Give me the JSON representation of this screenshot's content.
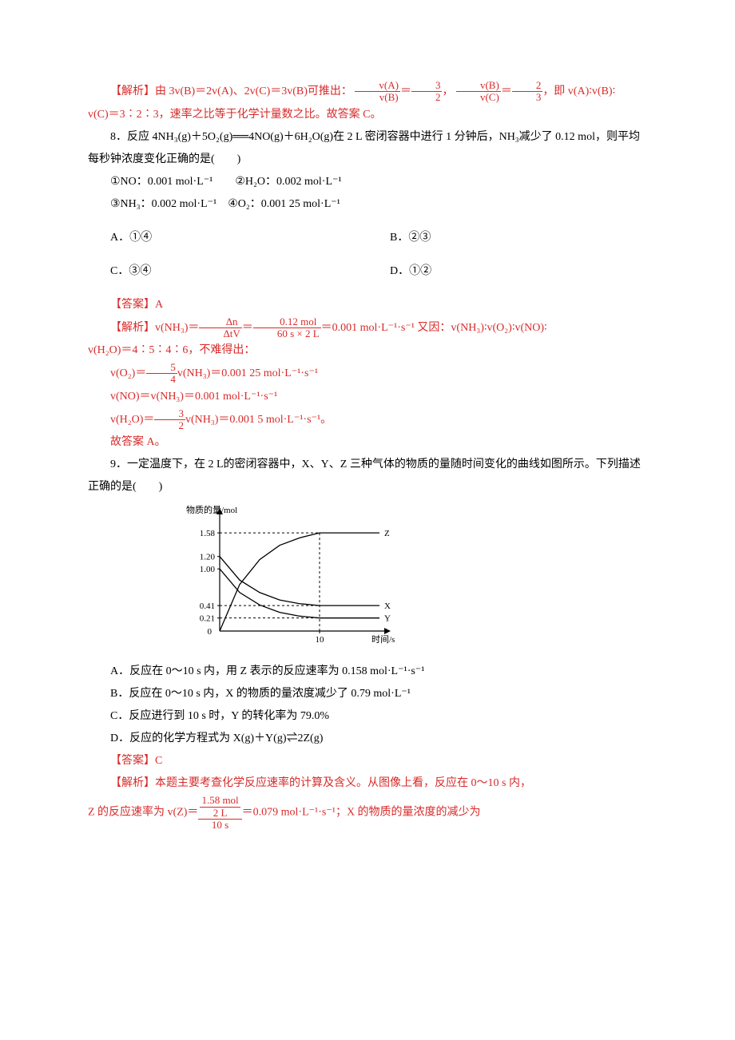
{
  "q7": {
    "analysis_prefix": "【解析】",
    "analysis_body1": "由 3v(B)＝2v(A)、2v(C)＝3v(B)可推出：",
    "frac1_num": "v(A)",
    "frac1_den": "v(B)",
    "eq1": "＝",
    "frac2_num": "3",
    "frac2_den": "2",
    "sep1": "，",
    "frac3_num": "v(B)",
    "frac3_den": "v(C)",
    "frac4_num": "2",
    "frac4_den": "3",
    "tail1": "，即 v(A)∶v(B)∶",
    "line2": "v(C)＝3∶2∶3，速率之比等于化学计量数之比。故答案 C。"
  },
  "q8": {
    "stem": "8．反应 4NH₃(g)＋5O₂(g)══4NO(g)＋6H₂O(g)在 2 L 密闭容器中进行 1 分钟后，NH₃减少了 0.12 mol，则平均每秒钟浓度变化正确的是(　　)",
    "choices_line1": "①NO：0.001 mol·L⁻¹　　②H₂O：0.002 mol·L⁻¹",
    "choices_line2": "③NH₃：0.002 mol·L⁻¹　④O₂：0.001 25 mol·L⁻¹",
    "optA": "A．①④",
    "optB": "B．②③",
    "optC": "C．③④",
    "optD": "D．①②",
    "answer_label": "【答案】",
    "answer_val": "A",
    "analysis_prefix": "【解析】",
    "a1": "v(NH₃)＝",
    "f1_num": "Δn",
    "f1_den": "ΔtV",
    "eq": "＝",
    "f2_num": "0.12 mol",
    "f2_den": "60 s × 2 L",
    "a2": "＝0.001 mol·L⁻¹·s⁻¹ 又因：v(NH₃)∶v(O₂)∶v(NO)∶",
    "a3": "v(H₂O)＝4∶5∶4∶6，不难得出：",
    "l1a": "v(O₂)＝",
    "l1_num": "5",
    "l1_den": "4",
    "l1b": "v(NH₃)＝0.001 25 mol·L⁻¹·s⁻¹",
    "l2": "v(NO)＝v(NH₃)＝0.001 mol·L⁻¹·s⁻¹",
    "l3a": "v(H₂O)＝",
    "l3_num": "3",
    "l3_den": "2",
    "l3b": "v(NH₃)＝0.001 5 mol·L⁻¹·s⁻¹。",
    "conclusion": "故答案 A。"
  },
  "q9": {
    "stem": "9．一定温度下，在 2 L的密闭容器中，X、Y、Z 三种气体的物质的量随时间变化的曲线如图所示。下列描述正确的是(　　)",
    "optA": "A．反应在 0～10 s 内，用 Z 表示的反应速率为 0.158 mol·L⁻¹·s⁻¹",
    "optB": "B．反应在 0～10 s 内，X 的物质的量浓度减少了 0.79 mol·L⁻¹",
    "optC": "C．反应进行到 10 s 时，Y 的转化率为 79.0%",
    "optD": "D．反应的化学方程式为 X(g)＋Y(g)⇌2Z(g)",
    "answer_label": "【答案】",
    "answer_val": "C",
    "analysis_prefix": "【解析】",
    "analysis1": "本题主要考查化学反应速率的计算及含义。从图像上看，反应在 0～10 s 内，",
    "line2a": "Z 的反应速率为 v(Z)＝",
    "top_num": "1.58 mol",
    "top_den": "2 L",
    "bottom_den": "10 s",
    "line2b": "＝0.079 mol·L⁻¹·s⁻¹；X 的物质的量浓度的减少为"
  },
  "chart_data": {
    "type": "line",
    "xlabel": "时间/s",
    "ylabel": "物质的量/mol",
    "xlim": [
      0,
      16
    ],
    "ylim": [
      0,
      1.8
    ],
    "x_ticks": [
      0,
      10
    ],
    "y_ticks": [
      0,
      0.21,
      0.41,
      1.0,
      1.2,
      1.58
    ],
    "series": [
      {
        "name": "Z",
        "points": [
          [
            0,
            0
          ],
          [
            2,
            0.75
          ],
          [
            4,
            1.15
          ],
          [
            6,
            1.38
          ],
          [
            8,
            1.5
          ],
          [
            10,
            1.58
          ],
          [
            16,
            1.58
          ]
        ]
      },
      {
        "name": "X",
        "points": [
          [
            0,
            1.2
          ],
          [
            2,
            0.82
          ],
          [
            4,
            0.62
          ],
          [
            6,
            0.5
          ],
          [
            8,
            0.44
          ],
          [
            10,
            0.41
          ],
          [
            16,
            0.41
          ]
        ]
      },
      {
        "name": "Y",
        "points": [
          [
            0,
            1.0
          ],
          [
            2,
            0.62
          ],
          [
            4,
            0.42
          ],
          [
            6,
            0.3
          ],
          [
            8,
            0.24
          ],
          [
            10,
            0.21
          ],
          [
            16,
            0.21
          ]
        ]
      }
    ]
  }
}
